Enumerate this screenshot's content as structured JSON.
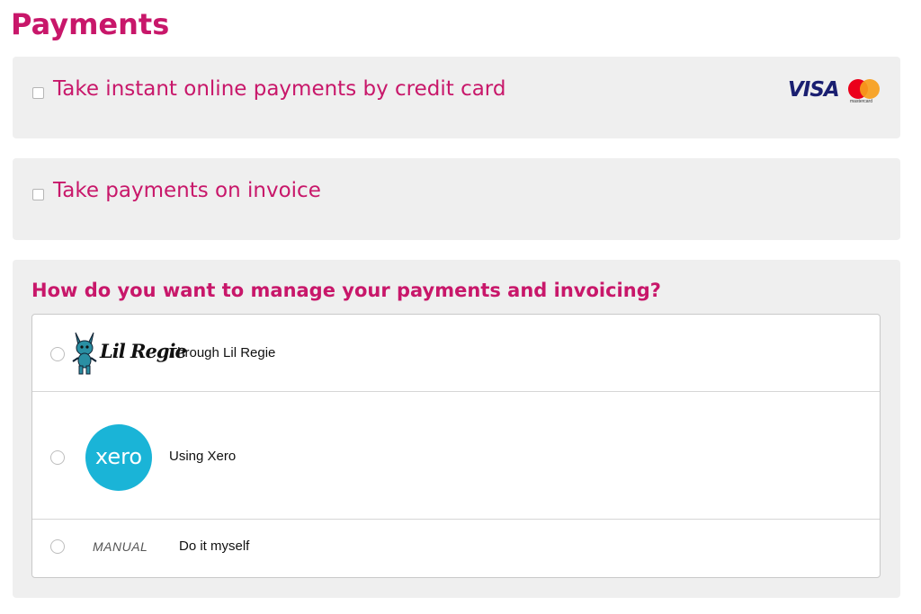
{
  "page": {
    "title": "Payments"
  },
  "credit_card": {
    "label": "Take instant online payments by credit card",
    "card_logos": {
      "visa": "VISA",
      "mastercard_caption": "mastercard"
    }
  },
  "invoice": {
    "label": "Take payments on invoice"
  },
  "manage": {
    "question": "How do you want to manage your payments and invoicing?",
    "options": [
      {
        "logo_text": "Lil Regie",
        "label": "Through Lil Regie"
      },
      {
        "logo_text": "xero",
        "label": "Using Xero"
      },
      {
        "logo_text": "MANUAL",
        "label": "Do it myself"
      }
    ]
  },
  "colors": {
    "accent": "#c8176a",
    "panel_bg": "#efefef",
    "xero": "#1ab4d7"
  }
}
